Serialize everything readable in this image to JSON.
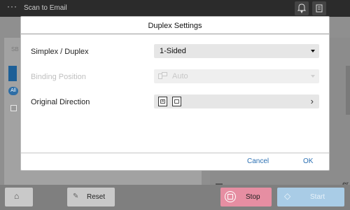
{
  "header": {
    "title": "Scan to Email",
    "menu_icon": "ellipsis-icon",
    "bell_icon": "bell-icon",
    "job_icon": "job-icon"
  },
  "background": {
    "left_label": "SB",
    "pill": "All",
    "right_tail": "er"
  },
  "dialog": {
    "title": "Duplex Settings",
    "rows": [
      {
        "label": "Simplex / Duplex",
        "value": "1-Sided",
        "enabled": true,
        "control": "dropdown"
      },
      {
        "label": "Binding Position",
        "value": "Auto",
        "enabled": false,
        "control": "dropdown"
      },
      {
        "label": "Original Direction",
        "value": "",
        "enabled": true,
        "control": "chevron"
      }
    ],
    "cancel_label": "Cancel",
    "ok_label": "OK"
  },
  "bottom": {
    "home_icon": "home-icon",
    "reset_label": "Reset",
    "stop_label": "Stop",
    "start_label": "Start"
  },
  "colors": {
    "accent": "#2a6fb2",
    "stop": "#e68ea2",
    "start": "#a9cce6"
  }
}
